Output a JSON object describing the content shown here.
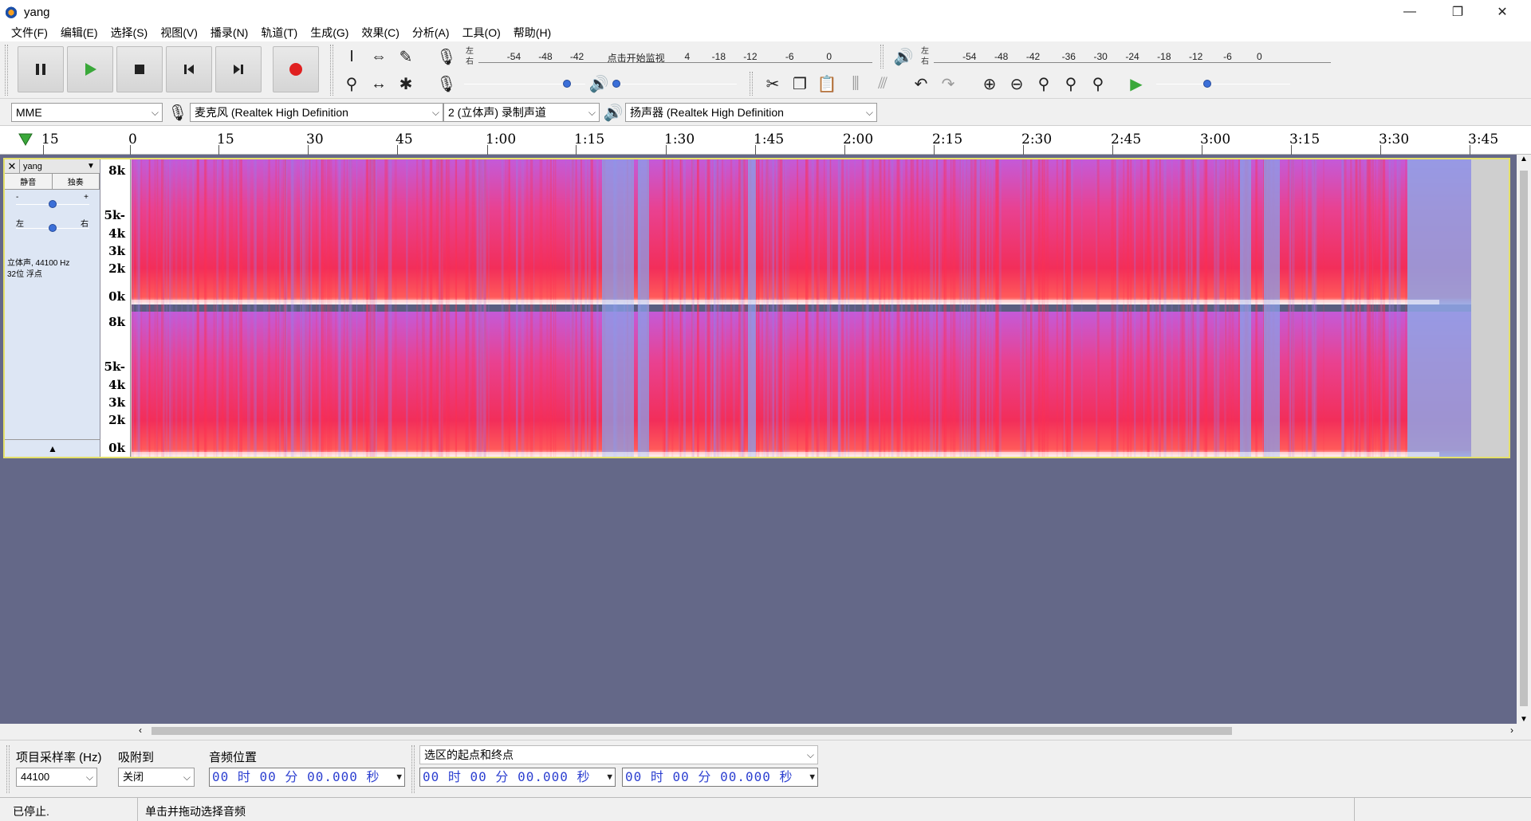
{
  "window": {
    "title": "yang",
    "controls": [
      "—",
      "❐",
      "✕"
    ]
  },
  "menu": [
    "文件(F)",
    "编辑(E)",
    "选择(S)",
    "视图(V)",
    "播录(N)",
    "轨道(T)",
    "生成(G)",
    "效果(C)",
    "分析(A)",
    "工具(O)",
    "帮助(H)"
  ],
  "transport": {
    "play_color": "#3aa83a",
    "record_color": "#e02020"
  },
  "record_meter": {
    "lr": "左\n右",
    "ticks": [
      "-54",
      "-48",
      "-42",
      "点击开始监视",
      "4",
      "-18",
      "-12",
      "-6",
      "0"
    ]
  },
  "play_meter": {
    "lr": "左\n右",
    "ticks": [
      "-54",
      "-48",
      "-42",
      "-36",
      "-30",
      "-24",
      "-18",
      "-12",
      "-6",
      "0"
    ]
  },
  "sliders": {
    "mic_level": 0.85,
    "speaker_level": 0.0,
    "play_speed": 0.38
  },
  "devices": {
    "host": "MME",
    "recording_device": "麦克风 (Realtek High Definition",
    "channels": "2 (立体声) 录制声道",
    "playback_device": "扬声器 (Realtek High Definition"
  },
  "timeline": {
    "labels": [
      "15",
      "0",
      "15",
      "30",
      "45",
      "1:00",
      "1:15",
      "1:30",
      "1:45",
      "2:00",
      "2:15",
      "2:30",
      "2:45",
      "3:00",
      "3:15",
      "3:30",
      "3:45"
    ]
  },
  "track": {
    "name": "yang",
    "mute": "静音",
    "solo": "独奏",
    "gain_minus": "-",
    "gain_plus": "+",
    "pan_left": "左",
    "pan_right": "右",
    "info_line1": "立体声, 44100 Hz",
    "info_line2": "32位 浮点",
    "gain_level": 0.5,
    "pan_level": 0.5,
    "freq_labels": [
      "8k",
      "5k-",
      "4k",
      "3k",
      "2k",
      "0k"
    ]
  },
  "selection_toolbar": {
    "rate_label": "项目采样率 (Hz)",
    "rate_value": "44100",
    "snap_label": "吸附到",
    "snap_value": "关闭",
    "pos_label": "音频位置",
    "pos_value": "00 时 00 分 00.000 秒",
    "sel_label": "选区的起点和终点",
    "sel_start": "00 时 00 分 00.000 秒",
    "sel_end": "00 时 00 分 00.000 秒"
  },
  "status": {
    "state": "已停止.",
    "hint": "单击并拖动选择音频"
  }
}
